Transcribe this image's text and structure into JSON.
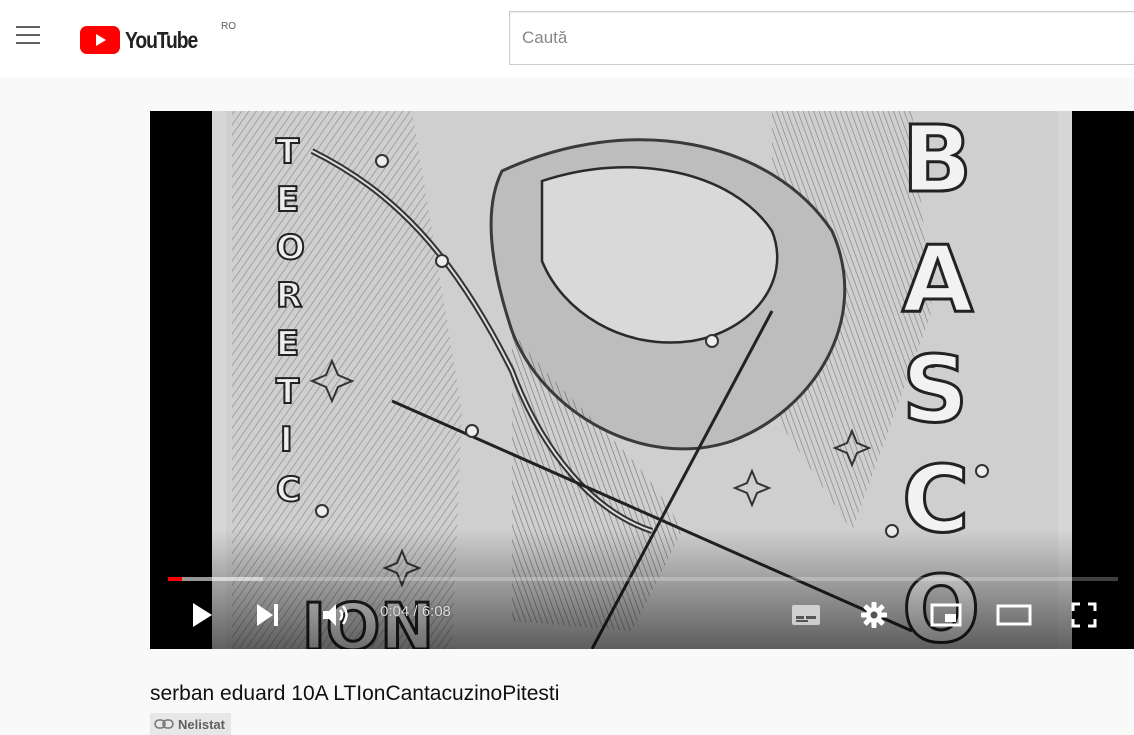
{
  "header": {
    "logo_text": "YouTube",
    "country_code": "RO",
    "search_placeholder": "Caută",
    "brand_color": "#ff0000"
  },
  "player": {
    "current_time": "0:04",
    "duration": "6:08",
    "time_display": "0:04 / 6:08",
    "progress_fraction": 0.011,
    "buffered_fraction": 0.1,
    "artwork_text": {
      "left_vertical": "TEORETIC",
      "right_vertical": "BASCO",
      "bottom": "ION"
    }
  },
  "video": {
    "title": "serban eduard 10A LTIonCantacuzinoPitesti",
    "visibility": "Nelistat",
    "visibility_icon": "link-icon"
  },
  "icons": {
    "menu": "menu-icon",
    "play": "play-icon",
    "next": "next-icon",
    "volume": "volume-icon",
    "subtitles": "subtitles-icon",
    "settings": "gear-icon",
    "miniplayer": "miniplayer-icon",
    "theater": "theater-mode-icon",
    "fullscreen": "fullscreen-icon"
  }
}
